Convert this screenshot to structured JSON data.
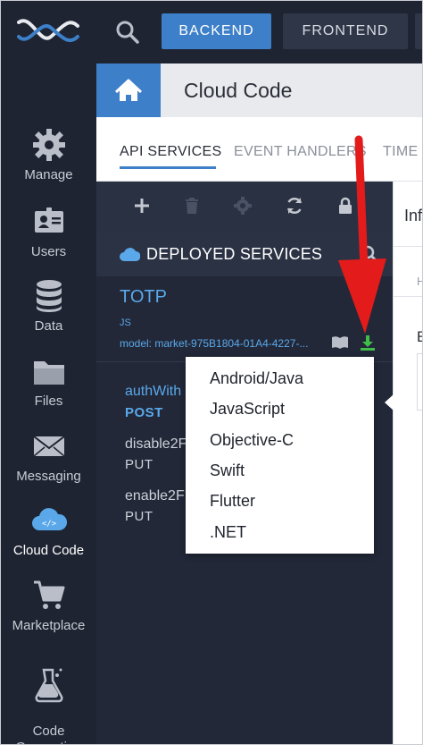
{
  "topbar": {
    "tabs": [
      {
        "label": "BACKEND"
      },
      {
        "label": "FRONTEND"
      }
    ]
  },
  "sidebar": {
    "items": [
      {
        "label": "Manage",
        "icon": "gear-icon"
      },
      {
        "label": "Users",
        "icon": "users-icon"
      },
      {
        "label": "Data",
        "icon": "database-icon"
      },
      {
        "label": "Files",
        "icon": "folder-icon"
      },
      {
        "label": "Messaging",
        "icon": "envelope-icon"
      },
      {
        "label": "Cloud Code",
        "icon": "cloud-code-icon",
        "active": true
      },
      {
        "label": "Marketplace",
        "icon": "cart-icon"
      },
      {
        "label": "Code\nGeneration",
        "icon": "flask-icon"
      }
    ]
  },
  "header": {
    "title": "Cloud Code"
  },
  "subtabs": [
    {
      "label": "API SERVICES",
      "active": true
    },
    {
      "label": "EVENT HANDLERS"
    },
    {
      "label": "TIME"
    }
  ],
  "panel": {
    "section_title": "DEPLOYED SERVICES",
    "service": {
      "name": "TOTP",
      "language": "JS",
      "model": "model: market-975B1804-01A4-4227-..."
    },
    "methods": [
      {
        "name": "authWith",
        "verb": "POST",
        "highlight": true
      },
      {
        "name": "disable2F",
        "verb": "PUT"
      },
      {
        "name": "enable2F",
        "verb": "PUT"
      }
    ]
  },
  "right_panel": {
    "heading_fragment": "Inf",
    "letter_h": "H",
    "letter_e": "E"
  },
  "download_menu": {
    "options": [
      "Android/Java",
      "JavaScript",
      "Objective-C",
      "Swift",
      "Flutter",
      ".NET"
    ]
  },
  "colors": {
    "accent": "#3d7fc8",
    "sidebar_bg": "#1e2432",
    "link": "#5aa8ea",
    "download_green": "#3fbf4a",
    "annotation_red": "#e31b1b"
  }
}
